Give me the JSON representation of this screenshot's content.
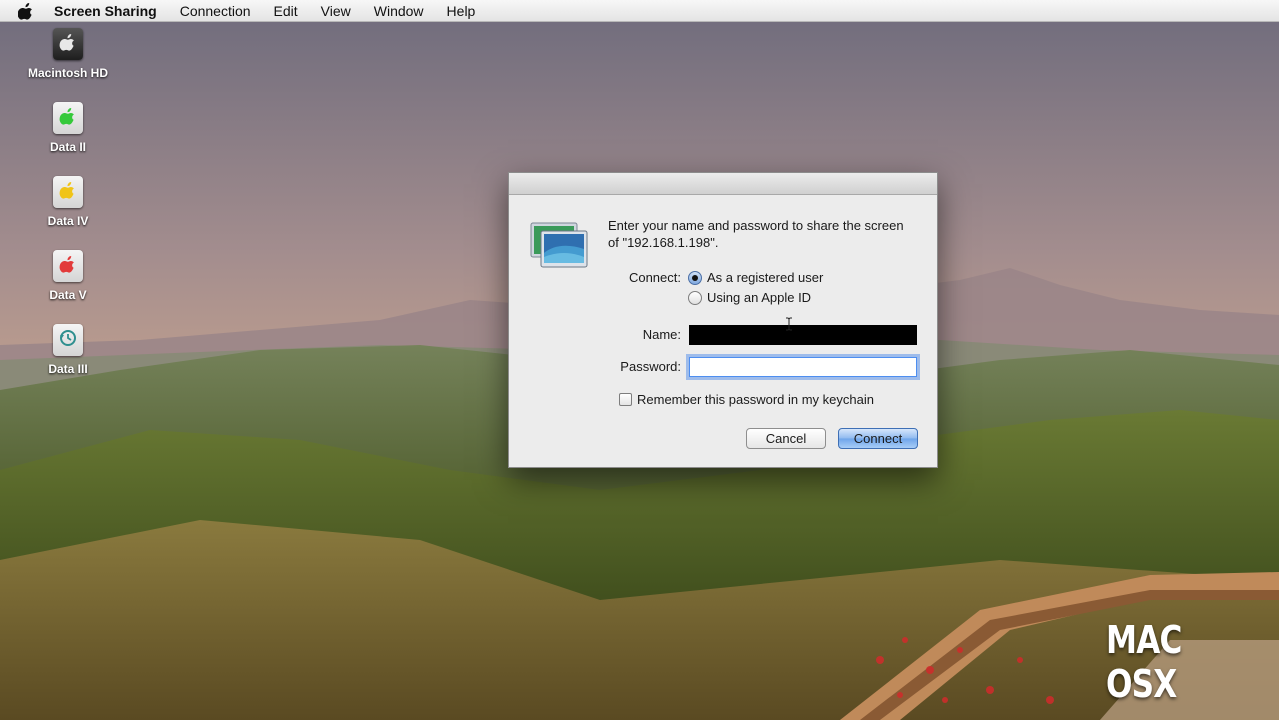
{
  "menubar": {
    "app_name": "Screen Sharing",
    "items": [
      "Connection",
      "Edit",
      "View",
      "Window",
      "Help"
    ]
  },
  "desktop": {
    "icons": [
      {
        "label": "Macintosh HD",
        "icon": "hard-drive-icon",
        "color": "#1e1e1e"
      },
      {
        "label": "Data II",
        "icon": "drive-apple-green-icon",
        "color": "#35c93a"
      },
      {
        "label": "Data IV",
        "icon": "drive-apple-yellow-icon",
        "color": "#f0c419"
      },
      {
        "label": "Data V",
        "icon": "drive-apple-red-icon",
        "color": "#e23a3a"
      },
      {
        "label": "Data III",
        "icon": "time-machine-drive-icon",
        "color": "#3aa0a0"
      }
    ]
  },
  "dialog": {
    "prompt": "Enter your name and password to share the screen of \"192.168.1.198\".",
    "connect_label": "Connect:",
    "options": [
      {
        "label": "As a registered user",
        "selected": true
      },
      {
        "label": "Using an Apple ID",
        "selected": false
      }
    ],
    "name_label": "Name:",
    "name_value": "",
    "password_label": "Password:",
    "password_value": "",
    "remember_label": "Remember this password in my keychain",
    "remember_checked": false,
    "cancel_label": "Cancel",
    "connect_button_label": "Connect"
  },
  "watermark": "MAC OSX",
  "colors": {
    "focus_ring": "#5f96eb",
    "default_button": "#6ea4ea"
  }
}
